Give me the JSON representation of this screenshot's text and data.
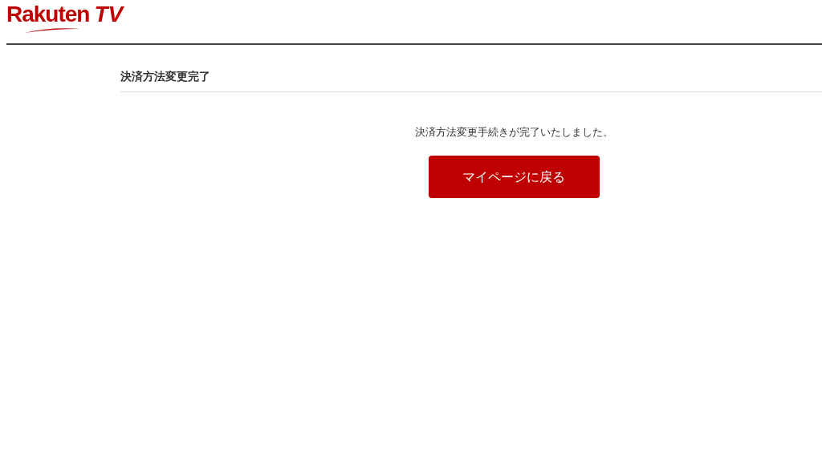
{
  "logo": {
    "brand": "Rakuten",
    "suffix": "TV"
  },
  "page_title": "決済方法変更完了",
  "message": "決済方法変更手続きが完了いたしました。",
  "button": {
    "label": "マイページに戻る"
  }
}
